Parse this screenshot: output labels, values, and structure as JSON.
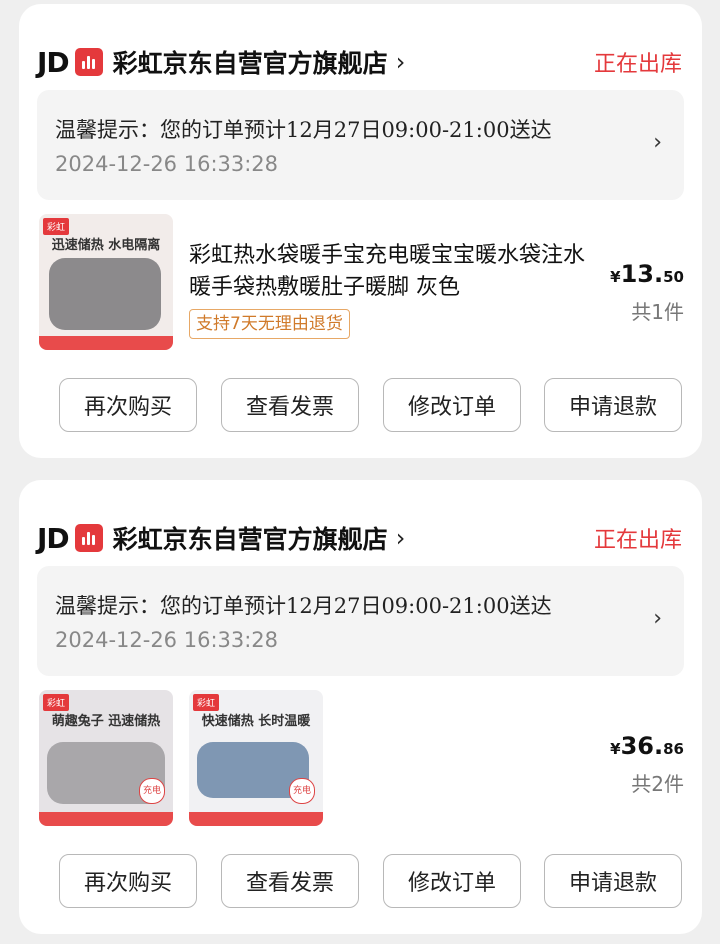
{
  "orders": [
    {
      "brand_logo_text": "JD",
      "shop_name": "彩虹京东自营官方旗舰店",
      "status": "正在出库",
      "tip": "温馨提示：您的订单预计12月27日09:00-21:00送达",
      "time": "2024-12-26 16:33:28",
      "product": {
        "title": "彩虹热水袋暖手宝充电暖宝宝暖水袋注水暖手袋热敷暖肚子暖脚 灰色",
        "tag": "支持7天无理由退货",
        "thumb_caption": "迅速储热 水电隔离",
        "thumb_logo": "彩虹"
      },
      "price_symbol": "¥",
      "price_int": "13.",
      "price_dec": "50",
      "count": "共1件",
      "buttons": [
        "再次购买",
        "查看发票",
        "修改订单",
        "申请退款"
      ]
    },
    {
      "brand_logo_text": "JD",
      "shop_name": "彩虹京东自营官方旗舰店",
      "status": "正在出库",
      "tip": "温馨提示：您的订单预计12月27日09:00-21:00送达",
      "time": "2024-12-26 16:33:28",
      "thumbs": [
        {
          "caption": "萌趣兔子 迅速储热",
          "logo": "彩虹",
          "badge": "充电"
        },
        {
          "caption": "快速储热 长时温暖",
          "logo": "彩虹",
          "badge": "充电"
        }
      ],
      "price_symbol": "¥",
      "price_int": "36.",
      "price_dec": "86",
      "count": "共2件",
      "buttons": [
        "再次购买",
        "查看发票",
        "修改订单",
        "申请退款"
      ]
    }
  ],
  "colors": {
    "accent": "#e4393c",
    "tag": "#d07a2a"
  },
  "icons": [
    "chevron-right-icon",
    "jd-store-icon"
  ]
}
